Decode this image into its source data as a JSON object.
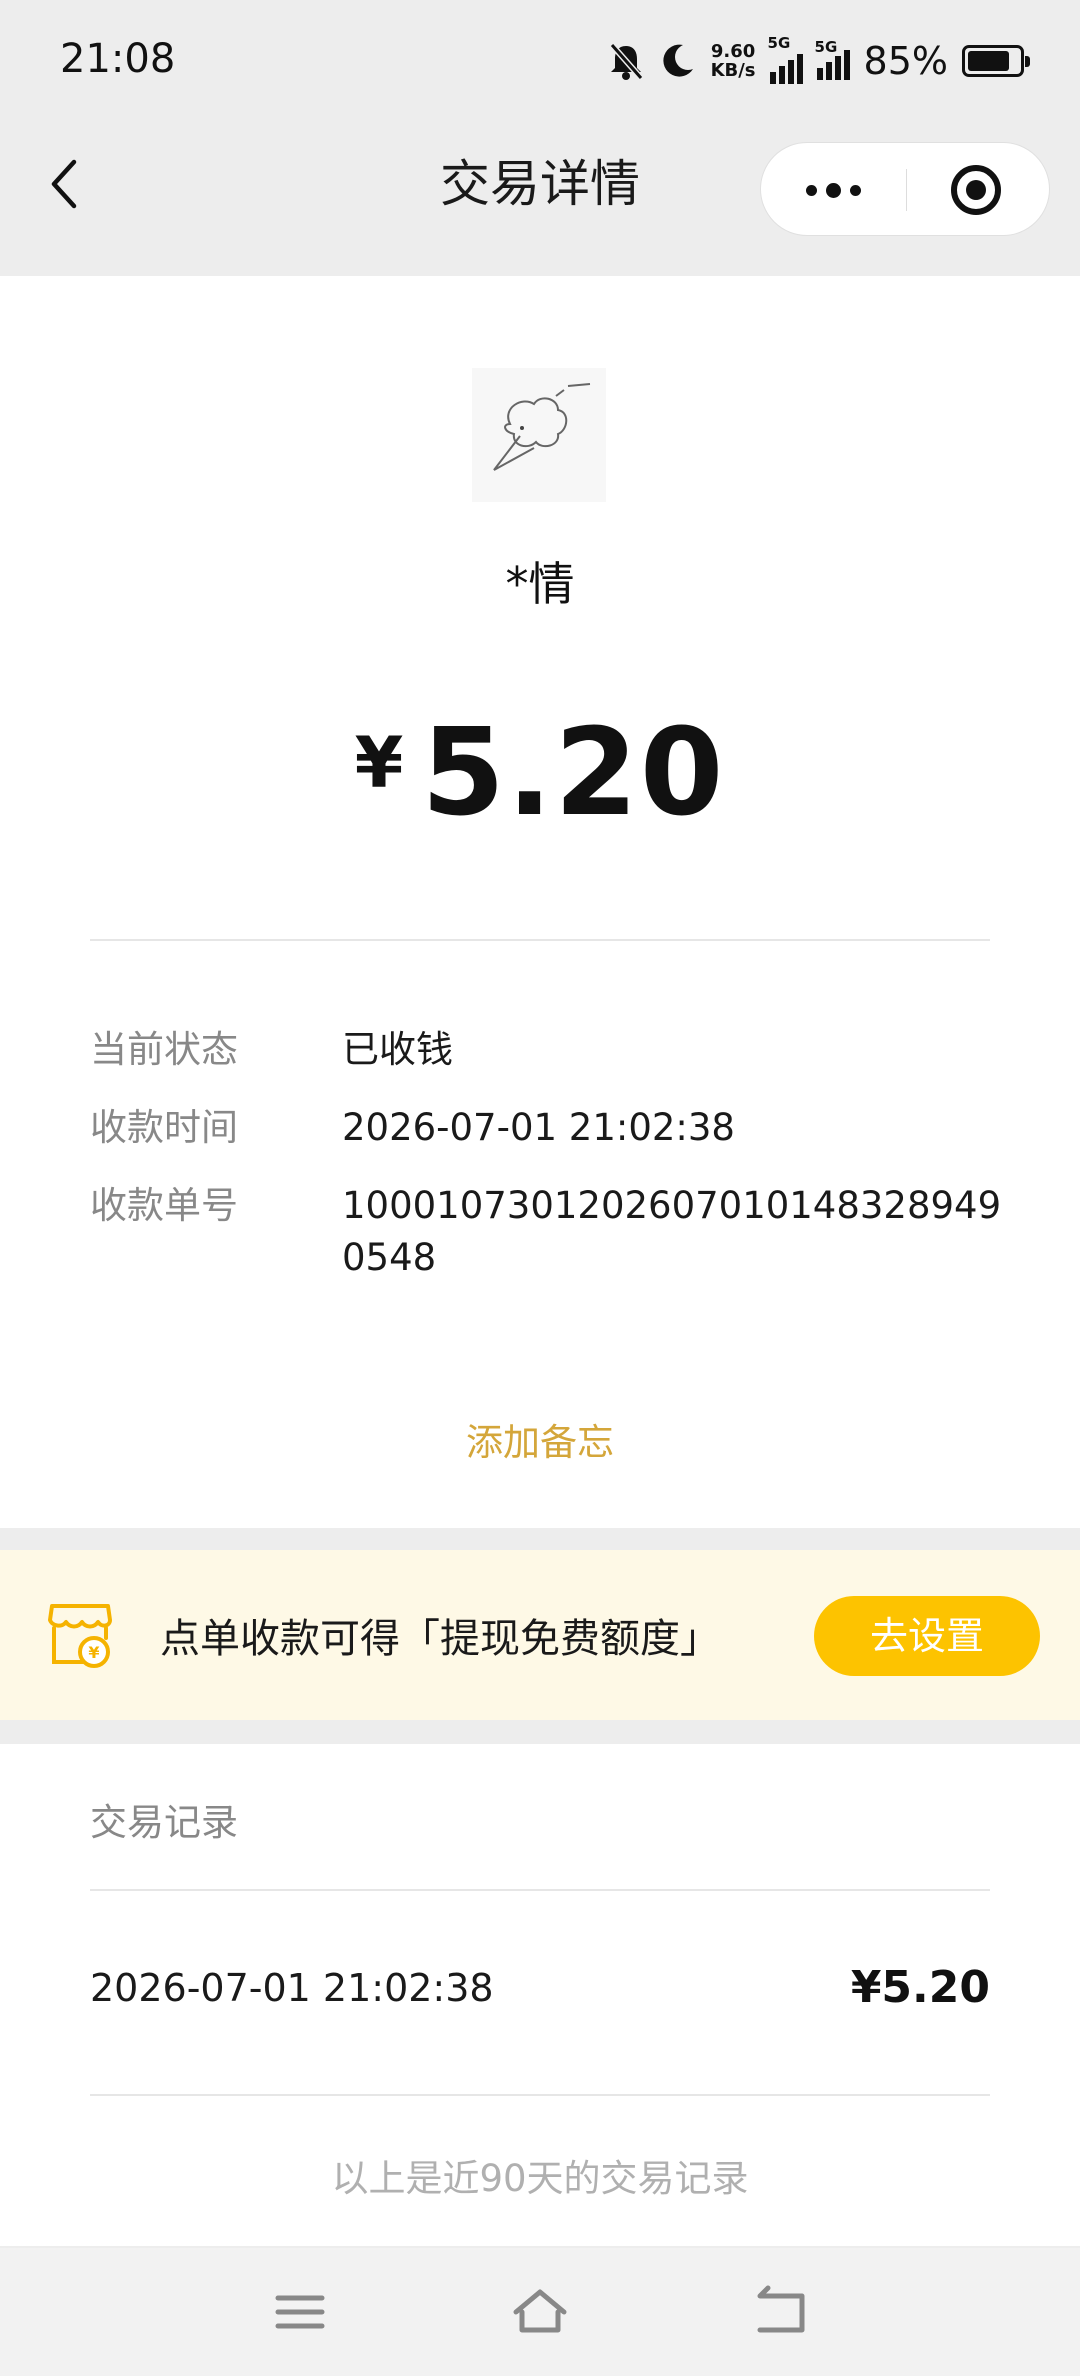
{
  "status_bar": {
    "time": "21:08",
    "net_speed_value": "9.60",
    "net_speed_unit": "KB/s",
    "sim1": "5G",
    "sim2": "5G",
    "battery": "85%",
    "battery_level": 0.85
  },
  "nav": {
    "title": "交易详情",
    "back_icon": "chevron-left-icon",
    "more_icon": "more-dots-icon",
    "close_icon": "target-circle-icon"
  },
  "payment": {
    "payer_name": "*情",
    "currency": "¥",
    "amount": "5.20"
  },
  "details": [
    {
      "label": "当前状态",
      "value": "已收钱"
    },
    {
      "label": "收款时间",
      "value": "2026-07-01 21:02:38"
    },
    {
      "label": "收款单号",
      "value": "100010730120260701014832894905​48"
    }
  ],
  "memo_link": "添加备忘",
  "promo": {
    "text": "点单收款可得「提现免费额度」",
    "button": "去设置",
    "icon": "shop-coin-icon",
    "button_color": "#fdc300"
  },
  "records": {
    "header": "交易记录",
    "items": [
      {
        "date": "2026-07-01 21:02:38",
        "amount": "¥5.20"
      }
    ],
    "footer": "以上是近90天的交易记录"
  },
  "colors": {
    "accent_gold": "#d4a63a",
    "promo_bg": "#fef9e6",
    "page_bg": "#ededed"
  }
}
